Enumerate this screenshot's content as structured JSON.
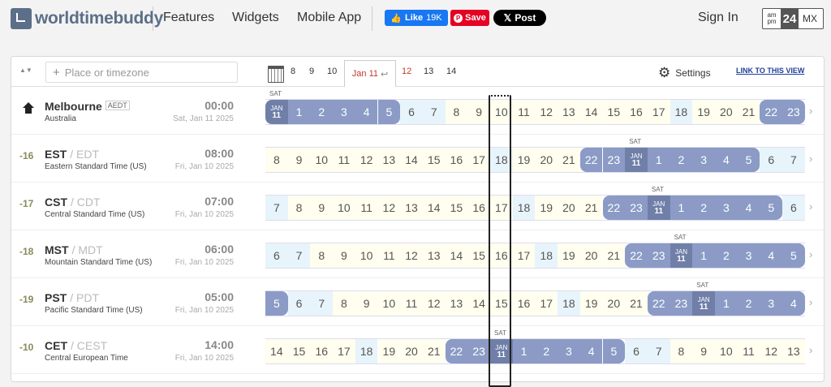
{
  "header": {
    "logo": "worldtimebuddy",
    "nav": [
      "Features",
      "Widgets",
      "Mobile App"
    ],
    "fb_like": "Like",
    "fb_count": "19K",
    "pin_save": "Save",
    "x_post": "Post",
    "sign_in": "Sign In",
    "format": {
      "am": "am",
      "pm": "pm",
      "h24": "24",
      "mx": "MX"
    }
  },
  "toolbar": {
    "search_placeholder": "Place or timezone",
    "days": [
      "8",
      "9",
      "10",
      "12",
      "13",
      "14"
    ],
    "active_day": "Jan 11",
    "settings": "Settings",
    "link": "LINK TO THIS VIEW"
  },
  "rows": [
    {
      "diff": "",
      "home": true,
      "name": "Melbourne",
      "alt": "",
      "badge": "AEDT",
      "sub": "Australia",
      "time": "00:00",
      "date": "Sat, Jan 11 2025",
      "hours": [
        "JAN|11",
        "1",
        "2",
        "3",
        "4",
        "5",
        "6",
        "7",
        "8",
        "9",
        "10",
        "11",
        "12",
        "13",
        "14",
        "15",
        "16",
        "17",
        "18",
        "19",
        "20",
        "21",
        "22",
        "23"
      ]
    },
    {
      "diff": "-16",
      "home": false,
      "name": "EST",
      "alt": "/ EDT",
      "badge": "",
      "sub": "Eastern Standard Time (US)",
      "time": "08:00",
      "date": "Fri, Jan 10 2025",
      "hours": [
        "8",
        "9",
        "10",
        "11",
        "12",
        "13",
        "14",
        "15",
        "16",
        "17",
        "18",
        "19",
        "20",
        "21",
        "22",
        "23",
        "JAN|11",
        "1",
        "2",
        "3",
        "4",
        "5",
        "6",
        "7"
      ]
    },
    {
      "diff": "-17",
      "home": false,
      "name": "CST",
      "alt": "/ CDT",
      "badge": "",
      "sub": "Central Standard Time (US)",
      "time": "07:00",
      "date": "Fri, Jan 10 2025",
      "hours": [
        "7",
        "8",
        "9",
        "10",
        "11",
        "12",
        "13",
        "14",
        "15",
        "16",
        "17",
        "18",
        "19",
        "20",
        "21",
        "22",
        "23",
        "JAN|11",
        "1",
        "2",
        "3",
        "4",
        "5",
        "6"
      ]
    },
    {
      "diff": "-18",
      "home": false,
      "name": "MST",
      "alt": "/ MDT",
      "badge": "",
      "sub": "Mountain Standard Time (US)",
      "time": "06:00",
      "date": "Fri, Jan 10 2025",
      "hours": [
        "6",
        "7",
        "8",
        "9",
        "10",
        "11",
        "12",
        "13",
        "14",
        "15",
        "16",
        "17",
        "18",
        "19",
        "20",
        "21",
        "22",
        "23",
        "JAN|11",
        "1",
        "2",
        "3",
        "4",
        "5"
      ]
    },
    {
      "diff": "-19",
      "home": false,
      "name": "PST",
      "alt": "/ PDT",
      "badge": "",
      "sub": "Pacific Standard Time (US)",
      "time": "05:00",
      "date": "Fri, Jan 10 2025",
      "hours": [
        "5",
        "6",
        "7",
        "8",
        "9",
        "10",
        "11",
        "12",
        "13",
        "14",
        "15",
        "16",
        "17",
        "18",
        "19",
        "20",
        "21",
        "22",
        "23",
        "JAN|11",
        "1",
        "2",
        "3",
        "4"
      ]
    },
    {
      "diff": "-10",
      "home": false,
      "name": "CET",
      "alt": "/ CEST",
      "badge": "",
      "sub": "Central European Time",
      "time": "14:00",
      "date": "Fri, Jan 10 2025",
      "hours": [
        "14",
        "15",
        "16",
        "17",
        "18",
        "19",
        "20",
        "21",
        "22",
        "23",
        "JAN|11",
        "1",
        "2",
        "3",
        "4",
        "5",
        "6",
        "7",
        "8",
        "9",
        "10",
        "11",
        "12",
        "13"
      ]
    }
  ],
  "sat_label": "SAT",
  "colors": {
    "night": "#8b9bc6",
    "midnight": "#6f7fa8",
    "dusk": "#e8f4fb",
    "day": "#fffeef",
    "brand": "#5c6f88",
    "fb": "#1877f2",
    "pin": "#e60023"
  }
}
